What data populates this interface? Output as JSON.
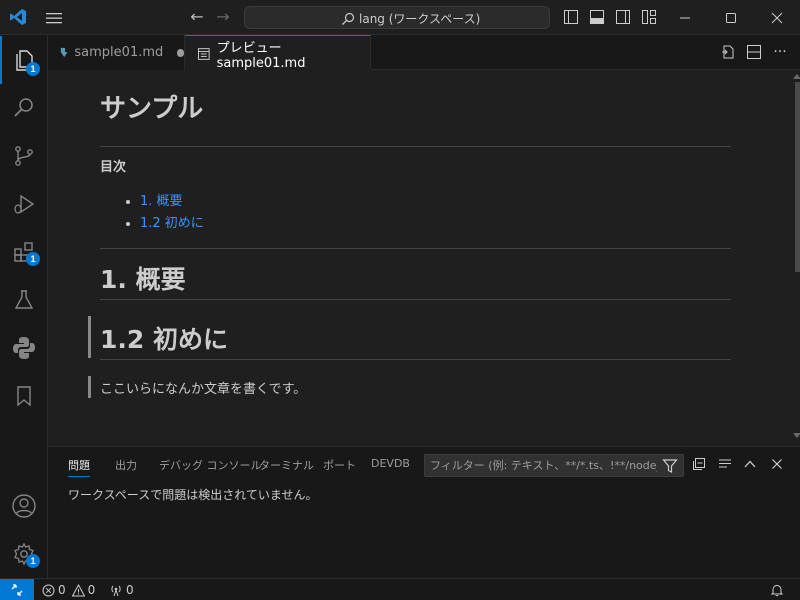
{
  "titlebar": {
    "search_text": "lang (ワークスペース)"
  },
  "activity": {
    "explorer_badge": "1",
    "extensions_badge": "1",
    "settings_badge": "1"
  },
  "tabs": [
    {
      "label": "sample01.md"
    },
    {
      "label": "プレビュー sample01.md"
    }
  ],
  "preview": {
    "title": "サンプル",
    "toc_title": "目次",
    "toc_items": [
      "1. 概要",
      "1.2 初めに"
    ],
    "h1": "1. 概要",
    "h2": "1.2 初めに",
    "paragraph": "ここいらになんか文章を書くです。"
  },
  "panel": {
    "tabs": [
      "問題",
      "出力",
      "デバッグ コンソール",
      "ターミナル",
      "ポート",
      "DEVDB"
    ],
    "filter_placeholder": "フィルター (例: テキスト、**/*.ts、!**/node_modules/**)",
    "message": "ワークスペースで問題は検出されていません。"
  },
  "status": {
    "errors": "0",
    "warnings": "0",
    "ports": "0"
  },
  "colors": {
    "accent": "#0078d4",
    "link": "#3794ff",
    "background": "#1f1f1f"
  }
}
